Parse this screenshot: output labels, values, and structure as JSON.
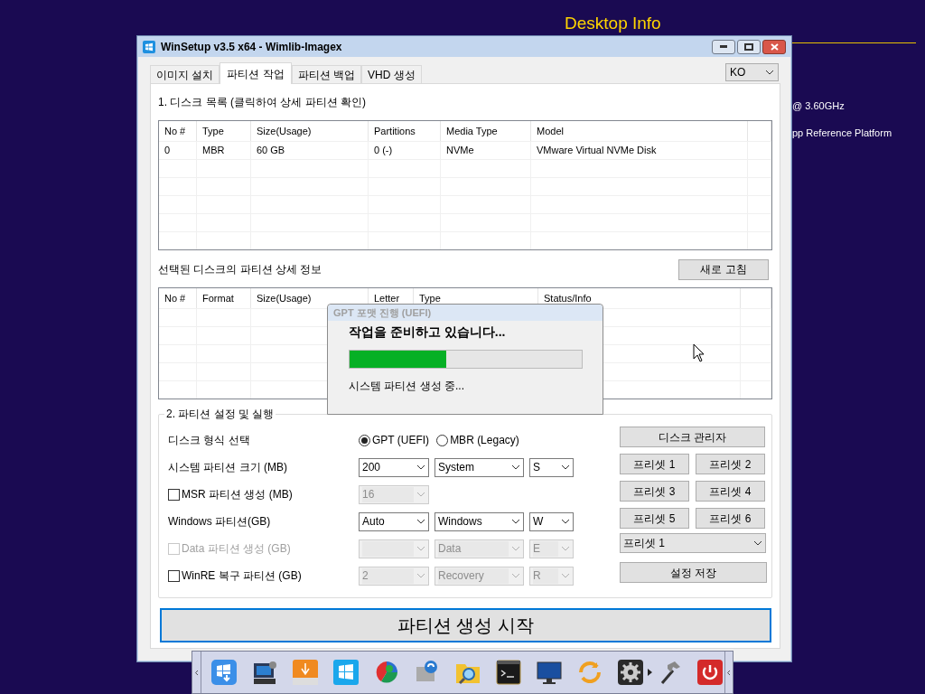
{
  "desktop_info": {
    "title": "Desktop Info",
    "lines": [
      "@ 3.60GHz",
      "pp Reference Platform"
    ]
  },
  "window": {
    "title": "WinSetup v3.5 x64 - Wimlib-Imagex",
    "language": "KO",
    "tabs": [
      {
        "label": "이미지 설치",
        "selected": false
      },
      {
        "label": "파티션 작업",
        "selected": true
      },
      {
        "label": "파티션 백업",
        "selected": false
      },
      {
        "label": "VHD 생성",
        "selected": false
      }
    ]
  },
  "disk_list": {
    "heading": "1. 디스크 목록 (클릭하여 상세 파티션 확인)",
    "columns": [
      "No #",
      "Type",
      "Size(Usage)",
      "Partitions",
      "Media Type",
      "Model"
    ],
    "rows": [
      [
        "0",
        "MBR",
        "60 GB",
        "0 (-)",
        "NVMe",
        "VMware Virtual NVMe Disk"
      ]
    ]
  },
  "partition_detail": {
    "heading": "선택된 디스크의 파티션 상세 정보",
    "refresh_button": "새로 고침",
    "columns": [
      "No #",
      "Format",
      "Size(Usage)",
      "Letter",
      "Type",
      "Status/Info"
    ]
  },
  "settings": {
    "legend": "2. 파티션 설정 및 실행",
    "rows": [
      {
        "kind": "radio",
        "label": "디스크 형식 선택",
        "options": [
          {
            "label": "GPT (UEFI)",
            "selected": true
          },
          {
            "label": "MBR (Legacy)",
            "selected": false
          }
        ]
      },
      {
        "kind": "combos",
        "label": "시스템 파티션 크기 (MB)",
        "combos": [
          {
            "value": "200",
            "disabled": false
          },
          {
            "value": "System",
            "disabled": false
          },
          {
            "value": "S",
            "disabled": false
          }
        ]
      },
      {
        "kind": "checkbox",
        "label": "MSR 파티션 생성 (MB)",
        "checked": false,
        "disabled": false,
        "combos": [
          {
            "value": "16",
            "disabled": true
          }
        ]
      },
      {
        "kind": "combos",
        "label": "Windows 파티션(GB)",
        "combos": [
          {
            "value": "Auto",
            "disabled": false
          },
          {
            "value": "Windows",
            "disabled": false
          },
          {
            "value": "W",
            "disabled": false
          }
        ]
      },
      {
        "kind": "checkbox",
        "label": "Data 파티션 생성 (GB)",
        "checked": false,
        "disabled": true,
        "combos": [
          {
            "disabled": true
          },
          {
            "value": "Data",
            "disabled": true
          },
          {
            "value": "E",
            "disabled": true
          }
        ]
      },
      {
        "kind": "checkbox",
        "label": "WinRE 복구 파티션 (GB)",
        "checked": false,
        "disabled": false,
        "combos": [
          {
            "value": "2",
            "disabled": true
          },
          {
            "value": "Recovery",
            "disabled": true
          },
          {
            "value": "R",
            "disabled": true
          }
        ]
      }
    ],
    "disk_manager_button": "디스크 관리자",
    "preset_buttons": [
      "프리셋 1",
      "프리셋 2",
      "프리셋 3",
      "프리셋 4",
      "프리셋 5",
      "프리셋 6"
    ],
    "preset_select": "프리셋 1",
    "save_button": "설정 저장"
  },
  "start_button": "파티션 생성 시작",
  "progress_dialog": {
    "title": "GPT 포맷 진행 (UEFI)",
    "message": "작업을 준비하고 있습니다...",
    "level": 0.415,
    "status": "시스템 파티션 생성 중..."
  }
}
